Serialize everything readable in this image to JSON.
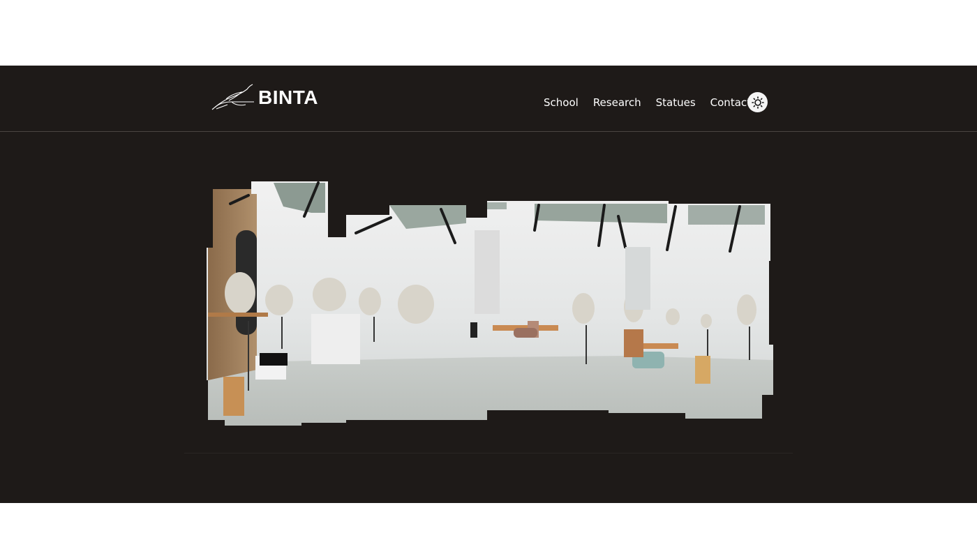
{
  "header": {
    "logo_text": "BINTA",
    "logo_icon": "quill-hand-icon",
    "nav": [
      {
        "label": "School"
      },
      {
        "label": "Research"
      },
      {
        "label": "Statues"
      },
      {
        "label": "Contact"
      }
    ],
    "theme_toggle_icon": "sun-icon"
  },
  "hero": {
    "image_subject": "panorama collage of sculpture studio with white statues on stands under skylights"
  },
  "colors": {
    "background": "#1e1a18",
    "page": "#ffffff",
    "text": "#ffffff",
    "header_border": "#4a4542"
  }
}
